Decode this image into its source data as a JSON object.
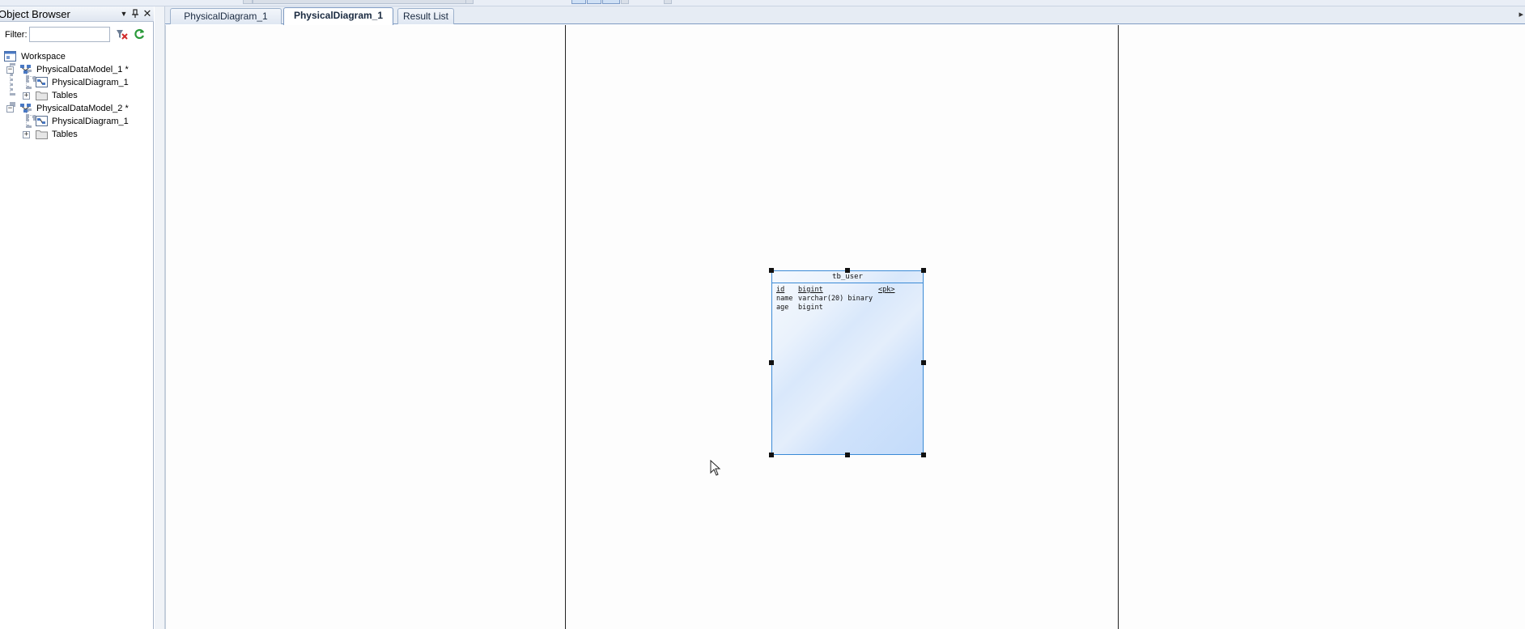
{
  "object_browser": {
    "title": "Object Browser",
    "buttons": {
      "dropdown": "▼",
      "pin": "📌",
      "close": "✕"
    },
    "filter": {
      "label": "Filter:",
      "value": ""
    },
    "tree": [
      {
        "label": "Workspace",
        "icon": "workspace-icon"
      },
      {
        "label": "PhysicalDataModel_1 *",
        "icon": "data-model-icon",
        "expander": "−"
      },
      {
        "label": "PhysicalDiagram_1",
        "icon": "diagram-icon"
      },
      {
        "label": "Tables",
        "icon": "folder-icon",
        "expander": "+"
      },
      {
        "label": "PhysicalDataModel_2 *",
        "icon": "data-model-icon",
        "expander": "−"
      },
      {
        "label": "PhysicalDiagram_1",
        "icon": "diagram-icon"
      },
      {
        "label": "Tables",
        "icon": "folder-icon",
        "expander": "+"
      }
    ]
  },
  "tabs": [
    {
      "label": "PhysicalDiagram_1",
      "active": false
    },
    {
      "label": "PhysicalDiagram_1",
      "active": true
    },
    {
      "label": "Result List",
      "active": false
    }
  ],
  "tab_overflow": "▸",
  "entity": {
    "name": "tb_user",
    "columns": [
      {
        "name": "id",
        "type": "bigint",
        "key": "<pk>"
      },
      {
        "name": "name",
        "type": "varchar(20) binary",
        "key": ""
      },
      {
        "name": "age",
        "type": "bigint",
        "key": ""
      }
    ]
  },
  "colors": {
    "accent": "#3a8ad6",
    "entity_fill": "#d9e8fb"
  }
}
